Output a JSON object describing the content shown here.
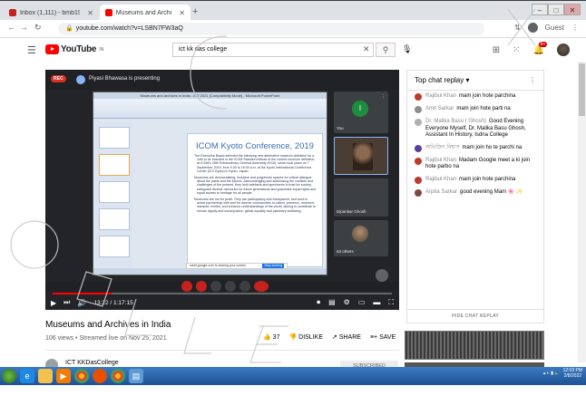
{
  "browser": {
    "tabs": [
      {
        "label": "Inbox (1,111) - bmb19@gmail...",
        "color": "#c5221f",
        "active": false
      },
      {
        "label": "Museums and Archives in India",
        "color": "#ff0000",
        "active": true
      }
    ],
    "new_tab": "+",
    "window_controls": [
      "–",
      "□",
      "✕"
    ],
    "url": "youtube.com/watch?v=LSBN7FW3aQ",
    "guest_label": "Guest"
  },
  "youtube": {
    "logo_text": "YouTube",
    "logo_country": "IN",
    "search_value": "ict kk das college",
    "notification_count": "9+"
  },
  "meet": {
    "rec_label": "REC",
    "presenting": "Piyasi Bhawasa is presenting",
    "ppt_window_title": "Museums and archives in India - ICT 2021 [Compatibility Mode] - Microsoft PowerPoint",
    "slide_title": "ICOM Kyoto Conference, 2019",
    "slide_bullets": [
      "The Executive Board selected the following new alternative museum definition for a vote to be included in the ICOM Statutes instead of the current museum definition at ICOM's 25th Extraordinary General Assembly (EGA), which took place on 7 September 2019, from 9.30 to 18.00 a.m. at the Kyoto International Conference Center (ICC Kyoto) in Kyoto, Japan:",
      "Museums are democratising, inclusive and polyphonic spaces for critical dialogue about the pasts and the futures. Acknowledging and addressing the conflicts and challenges of the present, they hold artefacts and specimens in trust for society, safeguard diverse memories for future generations and guarantee equal rights and equal access to heritage for all people.",
      "Museums are not for profit. They are participatory and transparent, and work in active partnership with and for diverse communities to collect, preserve, research, interpret, exhibit, and enhance understandings of the world, aiming to contribute to human dignity and social justice, global equality and planetary wellbeing."
    ],
    "tiles": [
      {
        "name": "You",
        "letter": "I",
        "color": "#1e8e3e"
      },
      {
        "name": "",
        "letter": "",
        "color": "#5a4636"
      },
      {
        "name": "Dipankar Ghosh",
        "letter": "",
        "color": "#7a6a5a"
      },
      {
        "name": "63 others",
        "letter": "",
        "color": "#6f5a46"
      }
    ],
    "share_bar_text": "meet.google.com is sharing your screen.",
    "share_bar_button": "Stop sharing",
    "click_to_add_notes": "Click to add notes"
  },
  "player": {
    "time": "13:22 / 1:17:15",
    "progress": 0.173
  },
  "video": {
    "title": "Museums and Archives in India",
    "meta": "106 views • Streamed live on Nov 25, 2021",
    "likes": "37",
    "dislike_label": "DISLIKE",
    "share_label": "SHARE",
    "save_label": "SAVE",
    "more": "...",
    "channel_name": "ICT KKDasCollege",
    "subscribe_label": "SUBSCRIBED"
  },
  "chat": {
    "header": "Top chat replay",
    "messages": [
      {
        "author": "Rajibul Khan",
        "text": "mam join hote parchina",
        "color": "#c0392b"
      },
      {
        "author": "Amit Sarkar",
        "text": "mam join hote parti na",
        "color": "#8e8e8e"
      },
      {
        "author": "Dr. Malika Basu ( Ghosh)",
        "text": "Good Evening Everyone Myself, Dr. Malika Basu Ghosh, Assistant In History, Isdna College",
        "color": "#b0b0b0"
      },
      {
        "author": "অভিজিৎ বিশ্বাস",
        "text": "mam join ho te parchi na",
        "color": "#5b3fa0"
      },
      {
        "author": "Rajibul Khan",
        "text": "Madam Google meet a ki join hote parbo na",
        "color": "#c0392b"
      },
      {
        "author": "Rajibul Khan",
        "text": "mam join hote parchina",
        "color": "#c0392b"
      },
      {
        "author": "Arpita Sarkar",
        "text": "good evening Mam 🌸 ✨",
        "color": "#7a4a3a"
      }
    ],
    "hide_label": "HIDE CHAT REPLAY"
  },
  "taskbar": {
    "time": "12:03 PM",
    "date": "2/8/2022"
  },
  "colors": {
    "youtube_red": "#ff0000",
    "taskbar_blue": "#2a64aa",
    "meet_red": "#c5221f"
  }
}
